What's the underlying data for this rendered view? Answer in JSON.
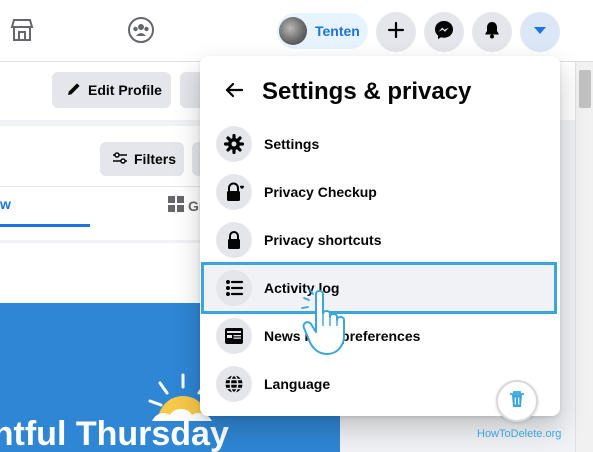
{
  "topbar": {
    "icons": [
      "marketplace-icon",
      "groups-icon"
    ],
    "profile_name": "Tenten",
    "buttons": [
      "plus-icon",
      "messenger-icon",
      "bell-icon",
      "caret-down-icon"
    ]
  },
  "profile": {
    "edit_profile_label": "Edit Profile"
  },
  "posts": {
    "filters_label": "Filters",
    "tab_list_partial": "w",
    "tab_grid_partial": "Gr"
  },
  "promo": {
    "text": "ghtful Thursday"
  },
  "dropdown": {
    "title": "Settings & privacy",
    "items": [
      {
        "label": "Settings",
        "icon": "gear-icon"
      },
      {
        "label": "Privacy Checkup",
        "icon": "lock-heart-icon"
      },
      {
        "label": "Privacy shortcuts",
        "icon": "lock-icon"
      },
      {
        "label": "Activity log",
        "icon": "list-icon",
        "highlighted": true
      },
      {
        "label": "News Feed preferences",
        "icon": "news-feed-icon"
      },
      {
        "label": "Language",
        "icon": "globe-icon"
      }
    ]
  },
  "watermark": "HowToDelete.org",
  "colors": {
    "accent": "#1b74e4",
    "highlight_border": "#3aa6dd",
    "promo_bg": "#2f86d4"
  }
}
